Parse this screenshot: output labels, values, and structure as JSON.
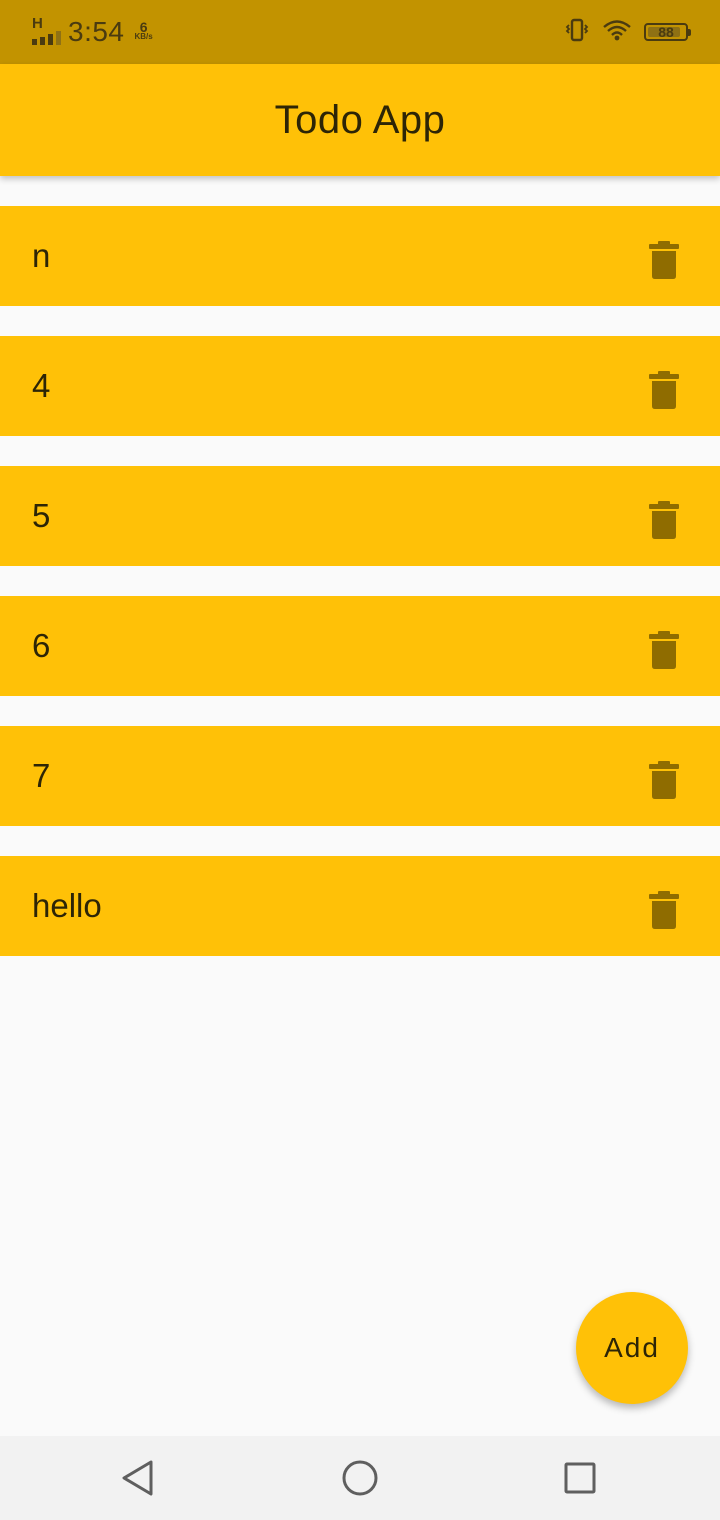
{
  "status_bar": {
    "network_type": "H",
    "time": "3:54",
    "data_speed_value": "6",
    "data_speed_unit": "KB/s",
    "battery_level": "88",
    "battery_fraction": 0.88,
    "icons": [
      "signal-icon",
      "vibrate-icon",
      "wifi-icon",
      "battery-icon"
    ]
  },
  "app_bar": {
    "title": "Todo App"
  },
  "todos": [
    {
      "text": "n"
    },
    {
      "text": "4"
    },
    {
      "text": "5"
    },
    {
      "text": "6"
    },
    {
      "text": "7"
    },
    {
      "text": "hello"
    }
  ],
  "fab": {
    "label": "Add"
  },
  "nav_bar": {
    "icons": [
      "back-icon",
      "home-icon",
      "recents-icon"
    ]
  },
  "colors": {
    "status_bar": "#c29300",
    "primary": "#ffc107",
    "icon": "#8f6c00",
    "background": "#fafafa",
    "text": "#2d2506"
  }
}
